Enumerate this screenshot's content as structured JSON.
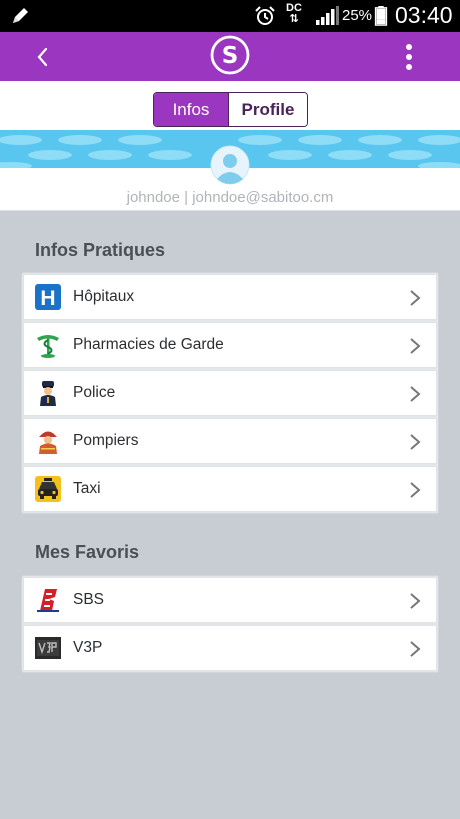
{
  "status_bar": {
    "battery_percent": "25%",
    "time": "03:40",
    "network_label_top": "DC",
    "network_label_bottom": "⇅"
  },
  "app_bar": {
    "logo_letter": "S",
    "accent_color": "#9b36c1"
  },
  "profile_tabs": {
    "tab_infos": "Infos",
    "tab_profile": "Profile",
    "active_tab": "Infos"
  },
  "user": {
    "line": "johndoe | johndoe@sabitoo.cm"
  },
  "infos_pratiques": {
    "title": "Infos Pratiques",
    "items": [
      {
        "label": "Hôpitaux",
        "icon": "hospital-icon"
      },
      {
        "label": "Pharmacies de Garde",
        "icon": "pharmacy-caduceus-icon"
      },
      {
        "label": "Police",
        "icon": "police-officer-icon"
      },
      {
        "label": "Pompiers",
        "icon": "firefighter-icon"
      },
      {
        "label": "Taxi",
        "icon": "taxi-icon"
      }
    ]
  },
  "mes_favoris": {
    "title": "Mes Favoris",
    "items": [
      {
        "label": "SBS",
        "icon": "sbs-logo-icon"
      },
      {
        "label": "V3P",
        "icon": "v3p-logo-icon"
      }
    ]
  }
}
